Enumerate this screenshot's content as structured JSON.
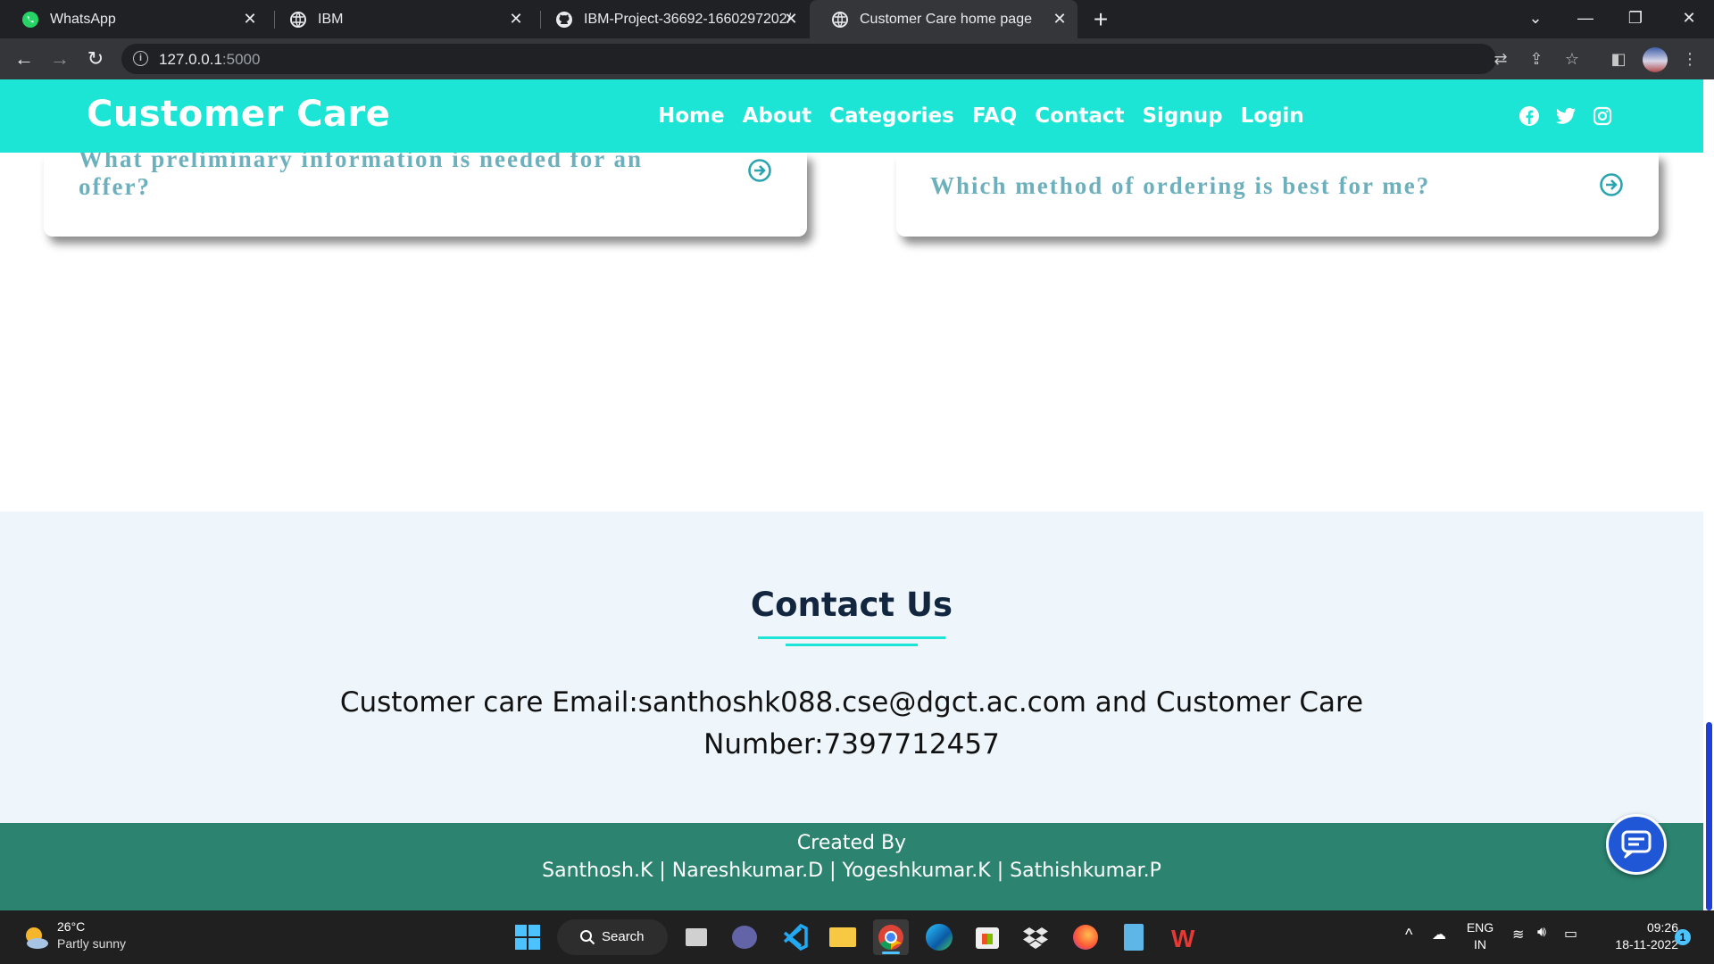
{
  "browser": {
    "tabs": [
      {
        "title": "WhatsApp",
        "icon": "whatsapp-icon"
      },
      {
        "title": "IBM",
        "icon": "globe-icon"
      },
      {
        "title": "IBM-Project-36692-1660297202/",
        "icon": "github-icon"
      },
      {
        "title": "Customer Care home page",
        "icon": "globe-icon",
        "active": true
      }
    ],
    "new_tab": "+",
    "url_host": "127.0.0.1",
    "url_port": ":5000"
  },
  "site": {
    "brand": "Customer Care",
    "nav": [
      "Home",
      "About",
      "Categories",
      "FAQ",
      "Contact",
      "Signup",
      "Login"
    ],
    "social": [
      "facebook-icon",
      "twitter-icon",
      "instagram-icon"
    ],
    "accent_color": "#1ce5d6"
  },
  "faq": {
    "left_question": "What preliminary information is needed for an offer?",
    "left_line1": "What preliminary information is needed for an",
    "left_line2": "offer?",
    "right_question": "Which method of ordering is best for me?"
  },
  "contact": {
    "title": "Contact Us",
    "line1": "Customer care Email:santhoshk088.cse@dgct.ac.com and Customer Care",
    "line2": "Number:7397712457"
  },
  "footer": {
    "created_by": "Created By",
    "names": "Santhosh.K | Nareshkumar.D | Yogeshkumar.K | Sathishkumar.P",
    "bg_color": "#2b8370"
  },
  "taskbar": {
    "weather_temp": "26°C",
    "weather_desc": "Partly sunny",
    "search_label": "Search",
    "lang_line1": "ENG",
    "lang_line2": "IN",
    "time": "09:26",
    "date": "18-11-2022",
    "notification_count": "1"
  }
}
